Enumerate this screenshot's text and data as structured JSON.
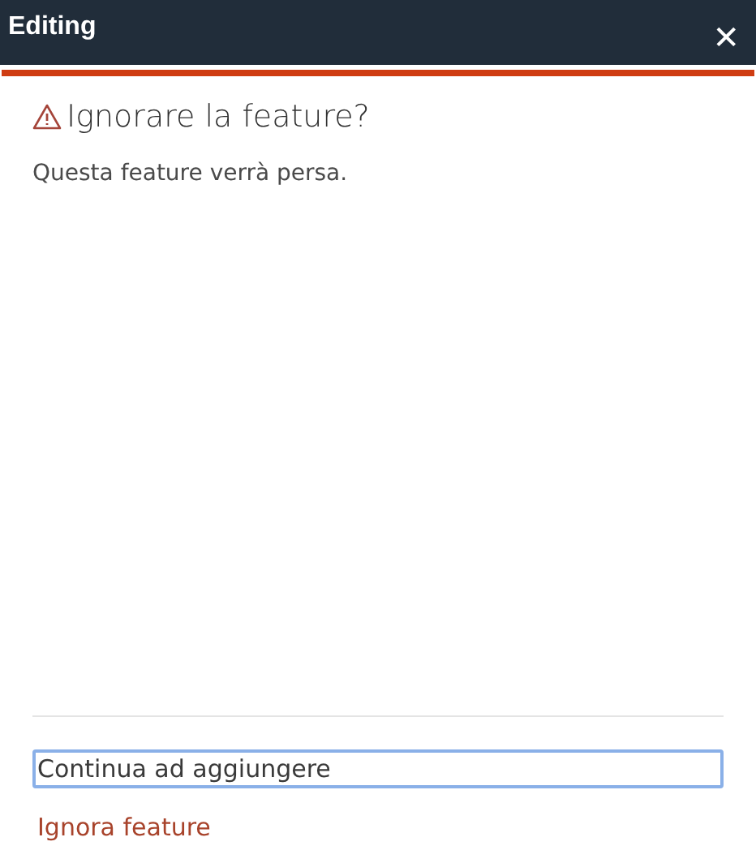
{
  "window": {
    "title": "Editing",
    "close": "✕"
  },
  "dialog": {
    "title": "Ignorare la feature?",
    "message": "Questa feature verrà persa."
  },
  "buttons": [
    {
      "label": "Continua ad aggiungere",
      "kind": "default",
      "focused": true
    },
    {
      "label": "Ignora feature",
      "kind": "danger",
      "focused": false
    }
  ]
}
